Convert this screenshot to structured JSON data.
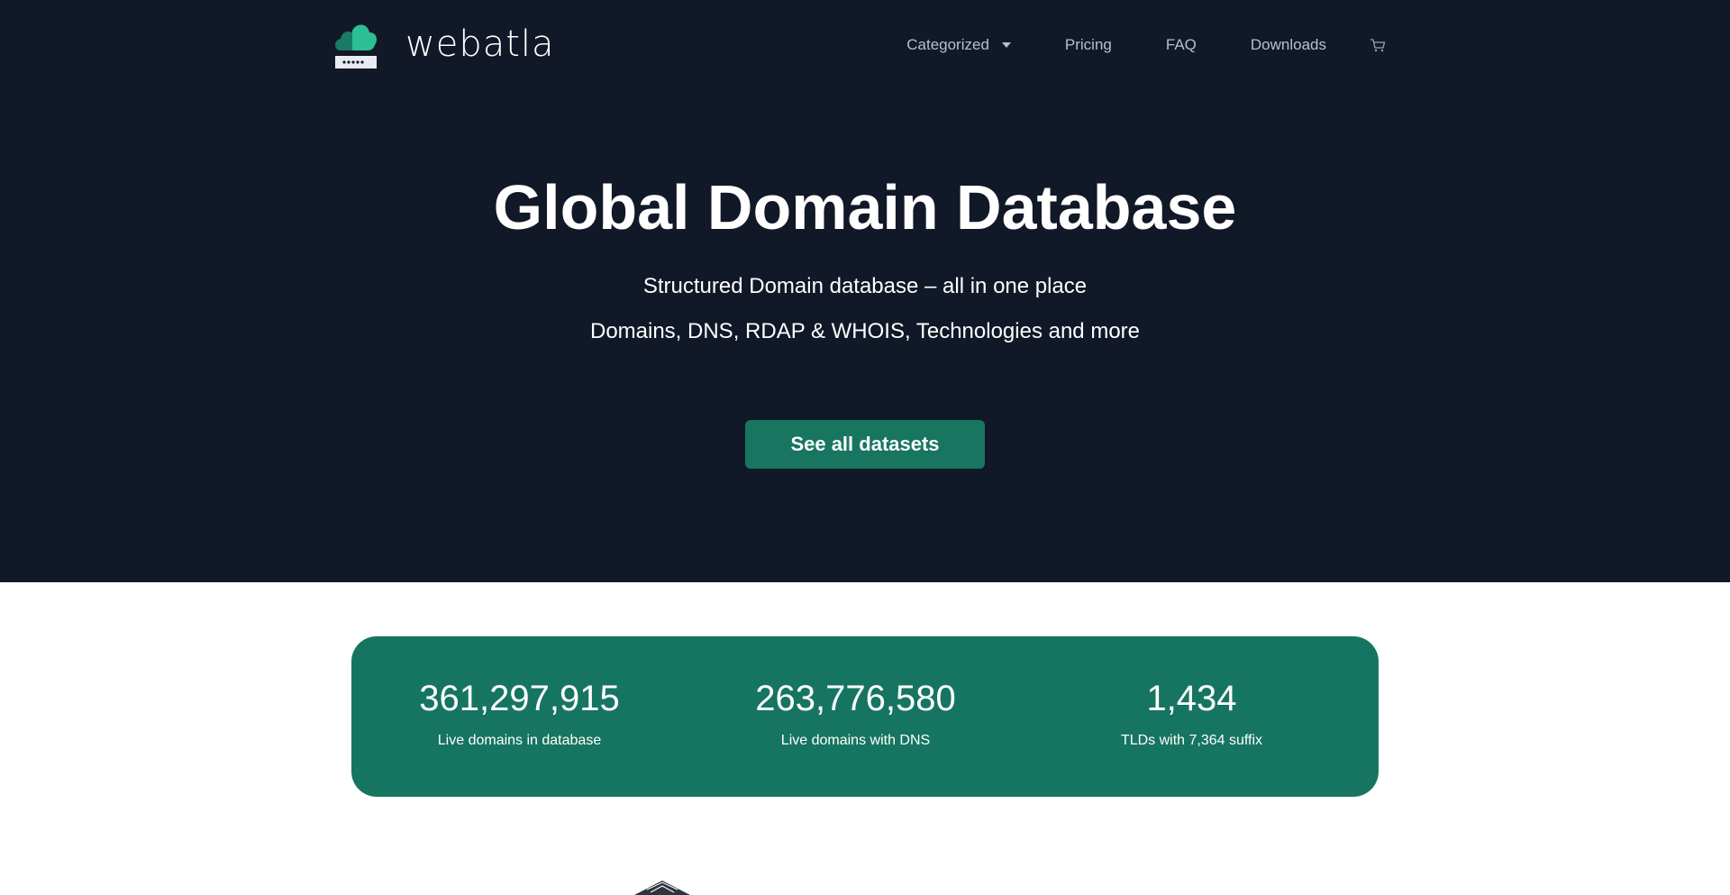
{
  "brand": {
    "name": "webatla",
    "accent_dark": "#1a7a63",
    "accent_light": "#2bbf93",
    "hero_bg": "#111827",
    "stats_bg": "#167560"
  },
  "nav": {
    "items": [
      "Categorized",
      "Pricing",
      "FAQ",
      "Downloads"
    ],
    "dropdown_icon": "caret-down-icon",
    "cart_icon": "cart-icon"
  },
  "hero": {
    "title": "Global Domain Database",
    "subtitle_1": "Structured Domain database – all in one place",
    "subtitle_2": "Domains, DNS, RDAP & WHOIS, Technologies and more",
    "cta_label": "See all datasets"
  },
  "stats": [
    {
      "value": "361,297,915",
      "label": "Live domains in database"
    },
    {
      "value": "263,776,580",
      "label": "Live domains with DNS"
    },
    {
      "value": "1,434",
      "label": "TLDs with 7,364 suffix"
    }
  ]
}
